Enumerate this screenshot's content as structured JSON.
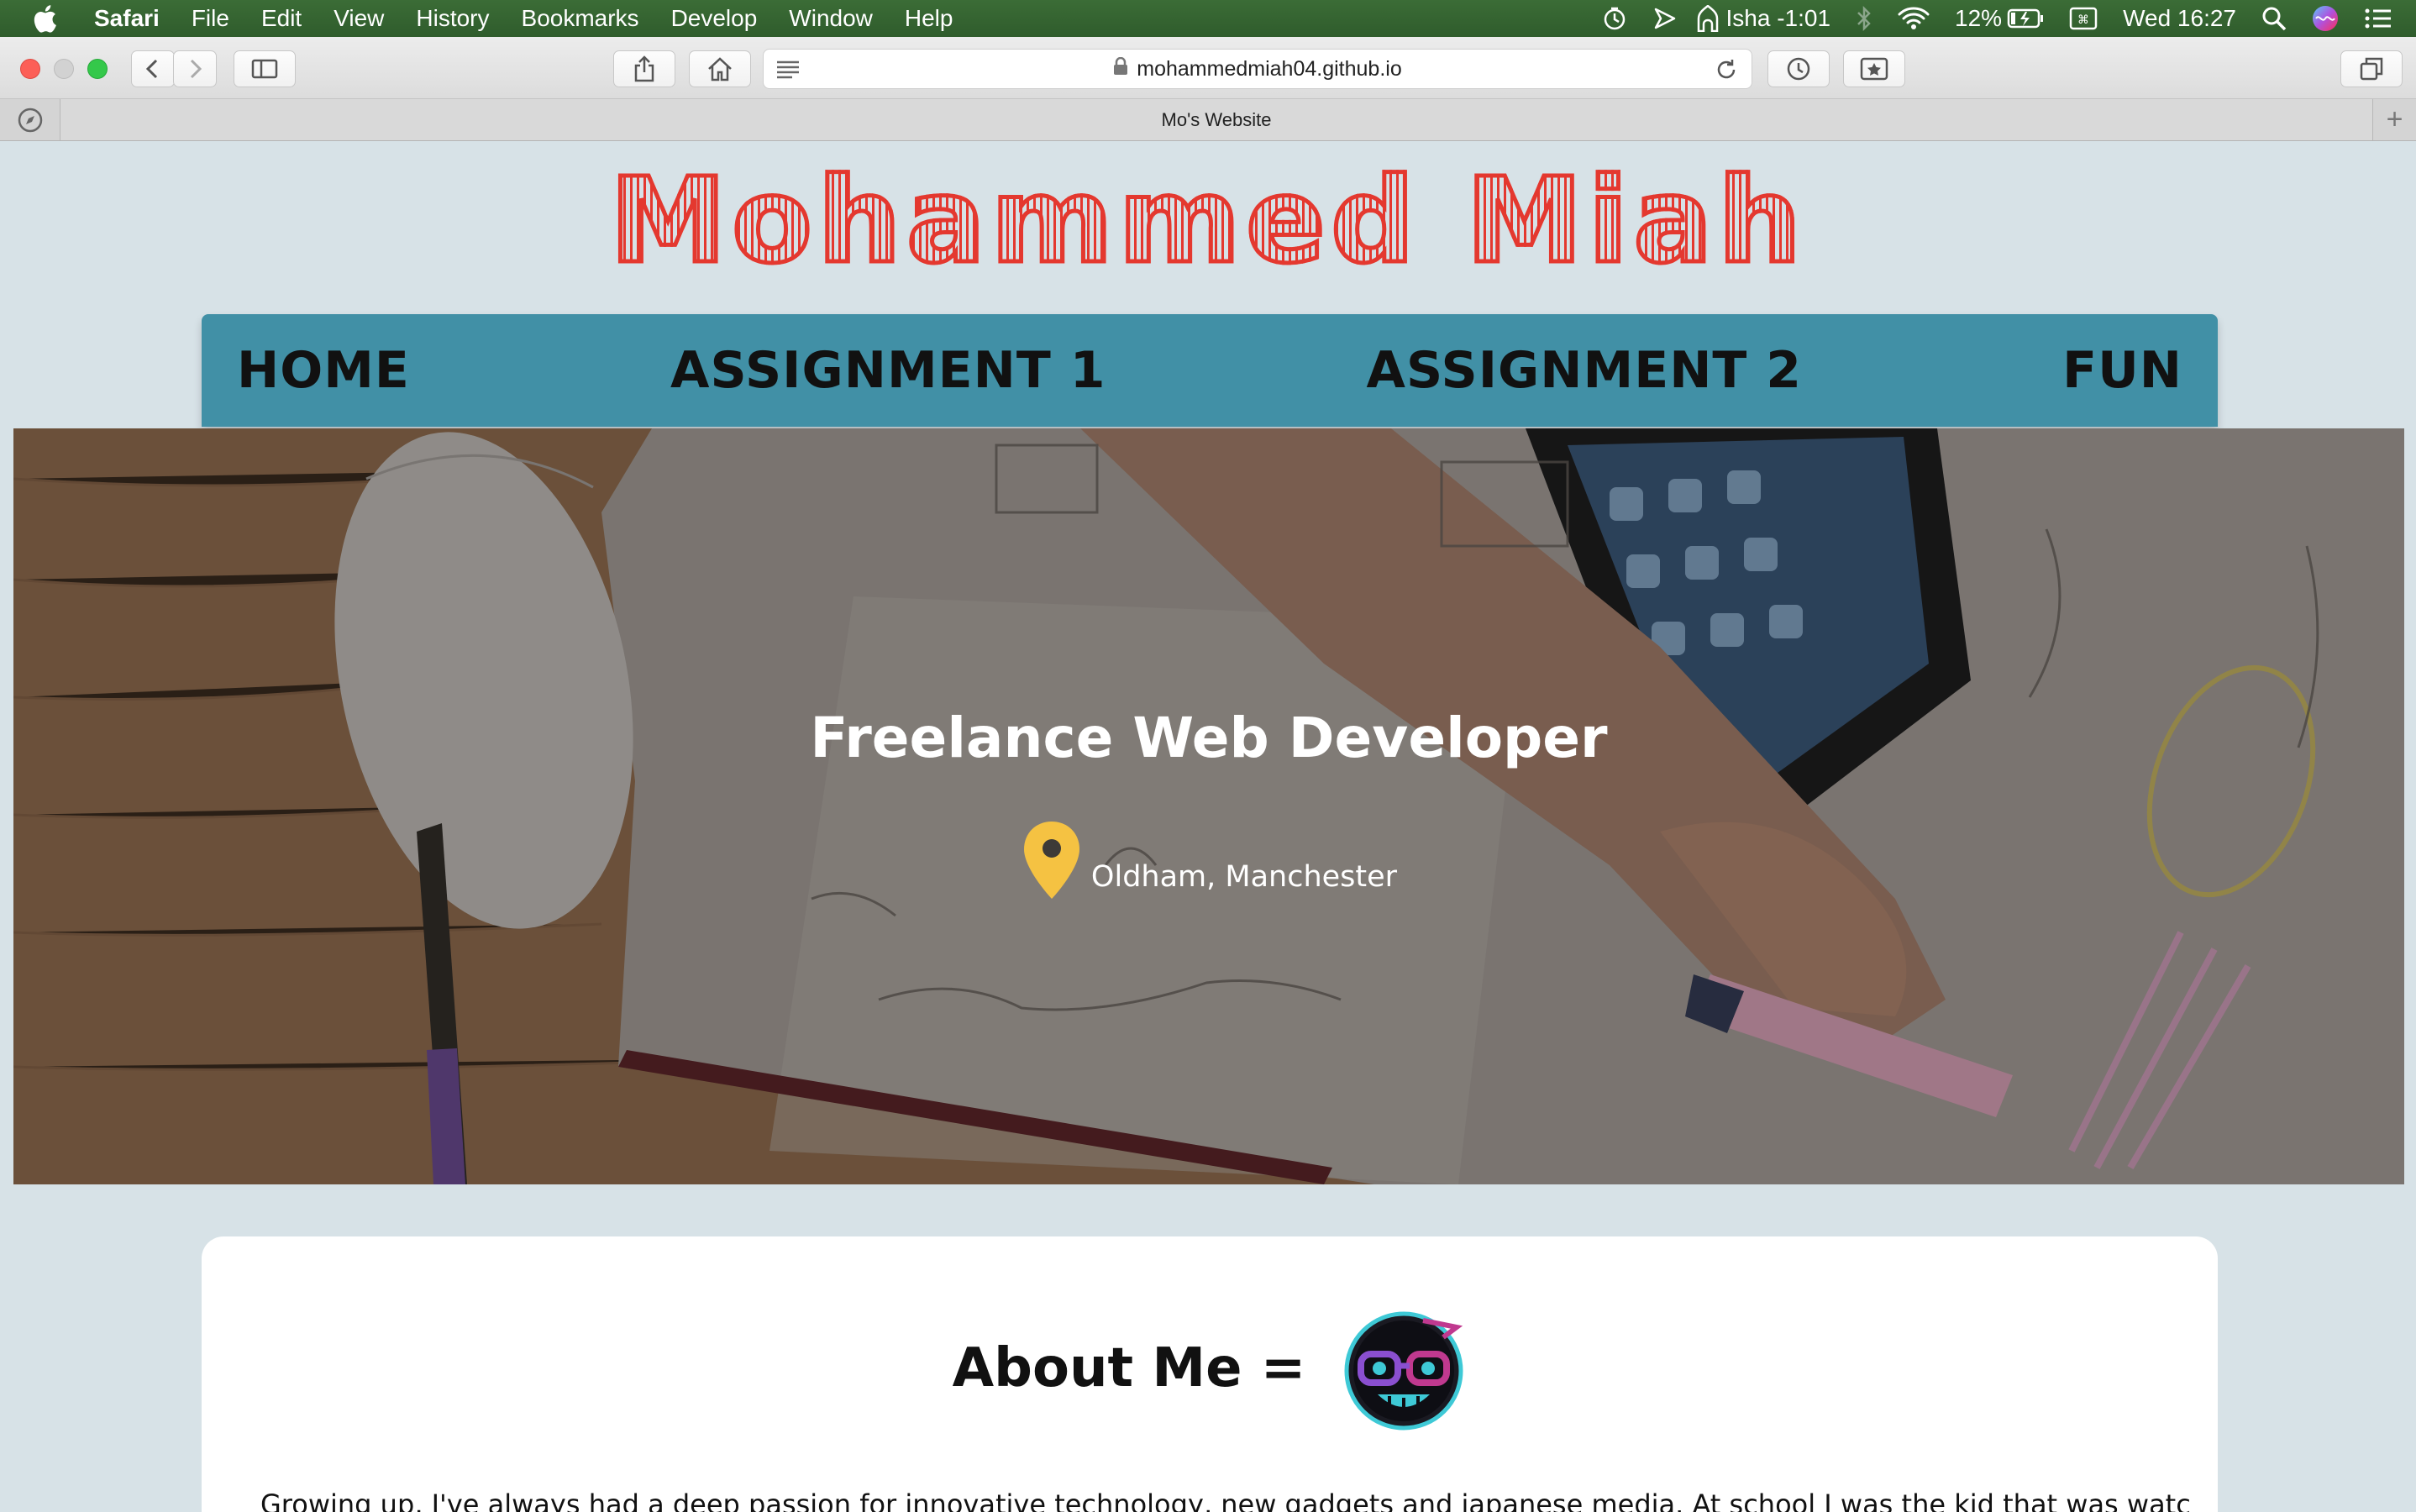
{
  "menubar": {
    "app": "Safari",
    "items": [
      "File",
      "Edit",
      "View",
      "History",
      "Bookmarks",
      "Develop",
      "Window",
      "Help"
    ],
    "prayer": "Isha -1:01",
    "battery": "12%",
    "clock": "Wed 16:27"
  },
  "browser": {
    "url": "mohammedmiah04.github.io",
    "tab_title": "Mo's Website",
    "new_tab": "+"
  },
  "site": {
    "title": "Mohammed Miah",
    "nav": [
      "HOME",
      "ASSIGNMENT 1",
      "ASSIGNMENT 2",
      "FUN"
    ],
    "hero": {
      "headline": "Freelance Web Developer",
      "location": "Oldham, Manchester",
      "pin_color": "#f5c242"
    },
    "about": {
      "title": "About Me =",
      "text": "Growing up, I've always had a deep passion for innovative technology, new gadgets and japanese media. At school I was the kid that was watching step"
    }
  },
  "colors": {
    "title_red": "#e4382f",
    "nav_bg": "#4190a6",
    "page_bg": "#d7e2e7"
  },
  "icons": [
    "apple-icon",
    "timer-icon",
    "location-arrow-icon",
    "mosque-icon",
    "bluetooth-icon",
    "wifi-icon",
    "battery-icon",
    "keyboard-icon",
    "spotlight-icon",
    "siri-icon",
    "notification-icon",
    "back-icon",
    "forward-icon",
    "sidebar-icon",
    "share-icon",
    "home-icon",
    "reader-icon",
    "lock-icon",
    "reload-icon",
    "history-icon",
    "bookmark-icon",
    "tabs-overview-icon",
    "compass-icon",
    "location-pin-icon",
    "avatar-icon"
  ]
}
